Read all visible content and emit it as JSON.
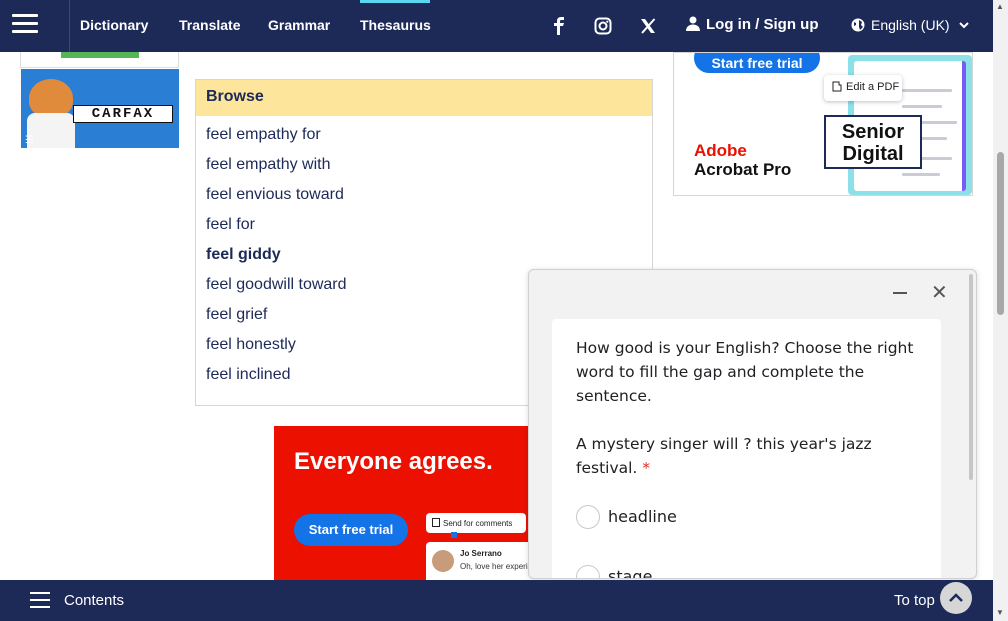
{
  "nav": {
    "links": [
      "Dictionary",
      "Translate",
      "Grammar",
      "Thesaurus"
    ],
    "active": "Thesaurus",
    "social_icons": [
      "facebook-icon",
      "instagram-icon",
      "x-icon"
    ],
    "login_label": "Log in / Sign up",
    "language_label": "English (UK)"
  },
  "left_ad": {
    "logo_text": "CARFAX"
  },
  "browse": {
    "title": "Browse",
    "items": [
      "feel empathy for",
      "feel empathy with",
      "feel envious toward",
      "feel for",
      "feel giddy",
      "feel goodwill toward",
      "feel grief",
      "feel honestly",
      "feel inclined"
    ],
    "current": "feel giddy"
  },
  "right_ad": {
    "cta": "Start free trial",
    "brand_line1": "Adobe",
    "brand_line2": "Acrobat Pro",
    "edit_chip": "Edit a PDF",
    "overlay_text_1": "Senior",
    "overlay_text_2": "Digital"
  },
  "bottom_ad": {
    "headline": "Everyone agrees.",
    "cta": "Start free trial",
    "chip": "Send for comments",
    "comment_name": "Jo Serrano",
    "comment_text": "Oh, love her experi"
  },
  "quiz": {
    "question": "How good is your English? Choose the right word to fill the gap and complete the sentence.",
    "prompt": "A mystery singer will ? this year's jazz festival.",
    "required_mark": "*",
    "options": [
      "headline",
      "stage"
    ]
  },
  "bottom_bar": {
    "contents_label": "Contents",
    "to_top_label": "To top"
  },
  "colors": {
    "nav_bg": "#1d2a57",
    "accent": "#5ad6f0",
    "browse_header": "#fde69b",
    "adobe_red": "#eb1000",
    "adobe_blue": "#1473e6"
  }
}
